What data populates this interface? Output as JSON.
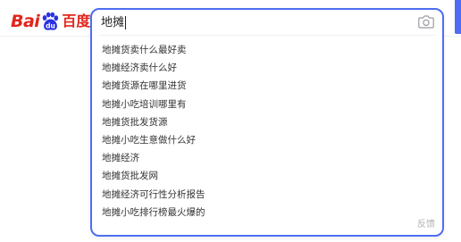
{
  "logo": {
    "left": "Bai",
    "right": "du",
    "chinese": "百度",
    "paw_icon": "baidu-paw-icon",
    "brand_color": "#e1251b"
  },
  "search": {
    "query": "地摊",
    "camera_icon": "camera-icon",
    "accent_color": "#4e6ef2"
  },
  "suggestions": [
    "地摊货卖什么最好卖",
    "地摊经济卖什么好",
    "地摊货源在哪里进货",
    "地摊小吃培训哪里有",
    "地摊货批发货源",
    "地摊小吃生意做什么好",
    "地摊经济",
    "地摊货批发网",
    "地摊经济可行性分析报告",
    "地摊小吃排行榜最火爆的"
  ],
  "feedback": "反馈"
}
